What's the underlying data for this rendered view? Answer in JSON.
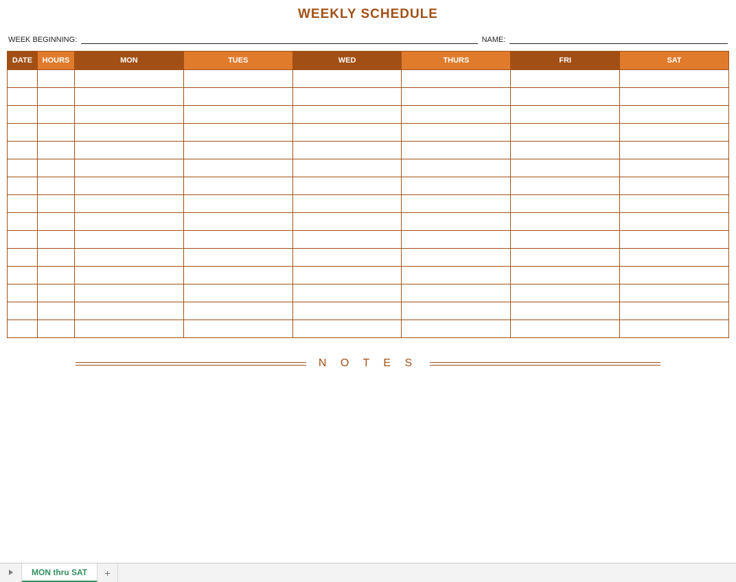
{
  "title": "WEEKLY SCHEDULE",
  "form": {
    "week_beginning_label": "WEEK BEGINNING:",
    "week_beginning_value": "",
    "name_label": "NAME:",
    "name_value": ""
  },
  "columns": {
    "date": "DATE",
    "hours": "HOURS",
    "mon": "MON",
    "tues": "TUES",
    "wed": "WED",
    "thurs": "THURS",
    "fri": "FRI",
    "sat": "SAT"
  },
  "row_count": 15,
  "notes_label": "N O T E S",
  "tabs": {
    "active": "MON thru SAT",
    "add": "+"
  }
}
